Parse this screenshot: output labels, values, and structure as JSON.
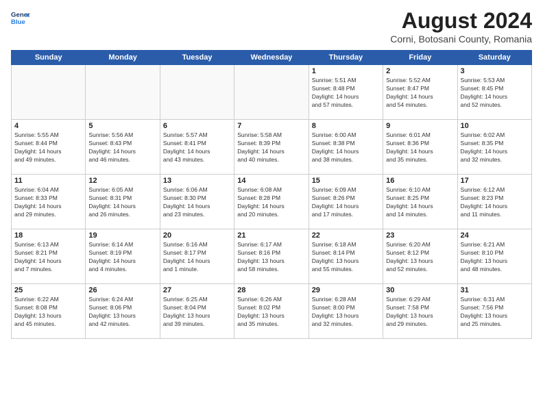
{
  "logo": {
    "line1": "General",
    "line2": "Blue"
  },
  "title": "August 2024",
  "location": "Corni, Botosani County, Romania",
  "weekdays": [
    "Sunday",
    "Monday",
    "Tuesday",
    "Wednesday",
    "Thursday",
    "Friday",
    "Saturday"
  ],
  "weeks": [
    [
      {
        "day": "",
        "info": ""
      },
      {
        "day": "",
        "info": ""
      },
      {
        "day": "",
        "info": ""
      },
      {
        "day": "",
        "info": ""
      },
      {
        "day": "1",
        "info": "Sunrise: 5:51 AM\nSunset: 8:48 PM\nDaylight: 14 hours\nand 57 minutes."
      },
      {
        "day": "2",
        "info": "Sunrise: 5:52 AM\nSunset: 8:47 PM\nDaylight: 14 hours\nand 54 minutes."
      },
      {
        "day": "3",
        "info": "Sunrise: 5:53 AM\nSunset: 8:45 PM\nDaylight: 14 hours\nand 52 minutes."
      }
    ],
    [
      {
        "day": "4",
        "info": "Sunrise: 5:55 AM\nSunset: 8:44 PM\nDaylight: 14 hours\nand 49 minutes."
      },
      {
        "day": "5",
        "info": "Sunrise: 5:56 AM\nSunset: 8:43 PM\nDaylight: 14 hours\nand 46 minutes."
      },
      {
        "day": "6",
        "info": "Sunrise: 5:57 AM\nSunset: 8:41 PM\nDaylight: 14 hours\nand 43 minutes."
      },
      {
        "day": "7",
        "info": "Sunrise: 5:58 AM\nSunset: 8:39 PM\nDaylight: 14 hours\nand 40 minutes."
      },
      {
        "day": "8",
        "info": "Sunrise: 6:00 AM\nSunset: 8:38 PM\nDaylight: 14 hours\nand 38 minutes."
      },
      {
        "day": "9",
        "info": "Sunrise: 6:01 AM\nSunset: 8:36 PM\nDaylight: 14 hours\nand 35 minutes."
      },
      {
        "day": "10",
        "info": "Sunrise: 6:02 AM\nSunset: 8:35 PM\nDaylight: 14 hours\nand 32 minutes."
      }
    ],
    [
      {
        "day": "11",
        "info": "Sunrise: 6:04 AM\nSunset: 8:33 PM\nDaylight: 14 hours\nand 29 minutes."
      },
      {
        "day": "12",
        "info": "Sunrise: 6:05 AM\nSunset: 8:31 PM\nDaylight: 14 hours\nand 26 minutes."
      },
      {
        "day": "13",
        "info": "Sunrise: 6:06 AM\nSunset: 8:30 PM\nDaylight: 14 hours\nand 23 minutes."
      },
      {
        "day": "14",
        "info": "Sunrise: 6:08 AM\nSunset: 8:28 PM\nDaylight: 14 hours\nand 20 minutes."
      },
      {
        "day": "15",
        "info": "Sunrise: 6:09 AM\nSunset: 8:26 PM\nDaylight: 14 hours\nand 17 minutes."
      },
      {
        "day": "16",
        "info": "Sunrise: 6:10 AM\nSunset: 8:25 PM\nDaylight: 14 hours\nand 14 minutes."
      },
      {
        "day": "17",
        "info": "Sunrise: 6:12 AM\nSunset: 8:23 PM\nDaylight: 14 hours\nand 11 minutes."
      }
    ],
    [
      {
        "day": "18",
        "info": "Sunrise: 6:13 AM\nSunset: 8:21 PM\nDaylight: 14 hours\nand 7 minutes."
      },
      {
        "day": "19",
        "info": "Sunrise: 6:14 AM\nSunset: 8:19 PM\nDaylight: 14 hours\nand 4 minutes."
      },
      {
        "day": "20",
        "info": "Sunrise: 6:16 AM\nSunset: 8:17 PM\nDaylight: 14 hours\nand 1 minute."
      },
      {
        "day": "21",
        "info": "Sunrise: 6:17 AM\nSunset: 8:16 PM\nDaylight: 13 hours\nand 58 minutes."
      },
      {
        "day": "22",
        "info": "Sunrise: 6:18 AM\nSunset: 8:14 PM\nDaylight: 13 hours\nand 55 minutes."
      },
      {
        "day": "23",
        "info": "Sunrise: 6:20 AM\nSunset: 8:12 PM\nDaylight: 13 hours\nand 52 minutes."
      },
      {
        "day": "24",
        "info": "Sunrise: 6:21 AM\nSunset: 8:10 PM\nDaylight: 13 hours\nand 48 minutes."
      }
    ],
    [
      {
        "day": "25",
        "info": "Sunrise: 6:22 AM\nSunset: 8:08 PM\nDaylight: 13 hours\nand 45 minutes."
      },
      {
        "day": "26",
        "info": "Sunrise: 6:24 AM\nSunset: 8:06 PM\nDaylight: 13 hours\nand 42 minutes."
      },
      {
        "day": "27",
        "info": "Sunrise: 6:25 AM\nSunset: 8:04 PM\nDaylight: 13 hours\nand 39 minutes."
      },
      {
        "day": "28",
        "info": "Sunrise: 6:26 AM\nSunset: 8:02 PM\nDaylight: 13 hours\nand 35 minutes."
      },
      {
        "day": "29",
        "info": "Sunrise: 6:28 AM\nSunset: 8:00 PM\nDaylight: 13 hours\nand 32 minutes."
      },
      {
        "day": "30",
        "info": "Sunrise: 6:29 AM\nSunset: 7:58 PM\nDaylight: 13 hours\nand 29 minutes."
      },
      {
        "day": "31",
        "info": "Sunrise: 6:31 AM\nSunset: 7:56 PM\nDaylight: 13 hours\nand 25 minutes."
      }
    ]
  ]
}
